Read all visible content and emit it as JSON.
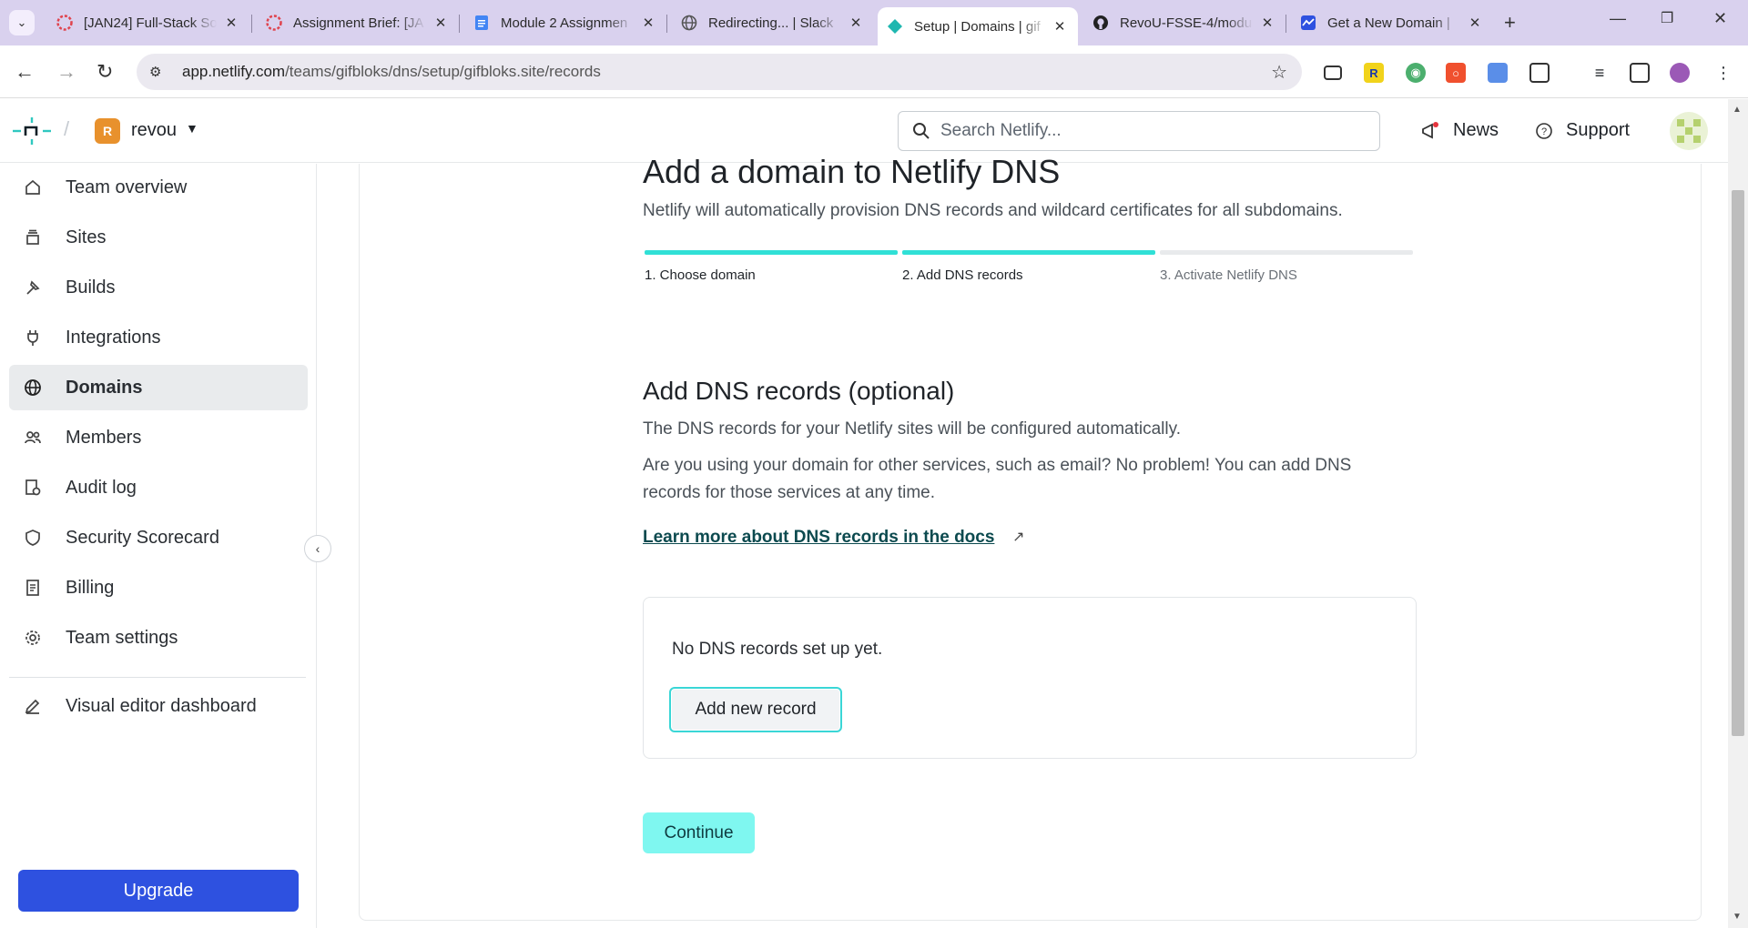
{
  "browser": {
    "tabs": [
      {
        "title": "[JAN24] Full-Stack So",
        "icon": "revou-icon"
      },
      {
        "title": "Assignment Brief: [JA",
        "icon": "revou-icon"
      },
      {
        "title": "Module 2 Assignmen",
        "icon": "docs-icon"
      },
      {
        "title": "Redirecting... | Slack",
        "icon": "globe-icon"
      },
      {
        "title": "Setup | Domains | gif",
        "icon": "netlify-icon",
        "active": true
      },
      {
        "title": "RevoU-FSSE-4/modu",
        "icon": "github-icon"
      },
      {
        "title": "Get a New Domain | ",
        "icon": "netlify-icon"
      }
    ],
    "url_host": "app.netlify.com",
    "url_path": "/teams/gifbloks/dns/setup/gifbloks.site/records"
  },
  "header": {
    "team_initial": "R",
    "team_name": "revou",
    "search_placeholder": "Search Netlify...",
    "news_label": "News",
    "support_label": "Support"
  },
  "sidebar": {
    "items": [
      {
        "label": "Team overview",
        "icon": "home-icon"
      },
      {
        "label": "Sites",
        "icon": "layers-icon"
      },
      {
        "label": "Builds",
        "icon": "hammer-icon"
      },
      {
        "label": "Integrations",
        "icon": "plug-icon"
      },
      {
        "label": "Domains",
        "icon": "globe-icon",
        "active": true
      },
      {
        "label": "Members",
        "icon": "users-icon"
      },
      {
        "label": "Audit log",
        "icon": "audit-icon"
      },
      {
        "label": "Security Scorecard",
        "icon": "shield-icon"
      },
      {
        "label": "Billing",
        "icon": "receipt-icon"
      },
      {
        "label": "Team settings",
        "icon": "gear-icon"
      }
    ],
    "visual_editor_label": "Visual editor dashboard",
    "upgrade_label": "Upgrade"
  },
  "main": {
    "title": "Add a domain to Netlify DNS",
    "subtitle": "Netlify will automatically provision DNS records and wildcard certificates for all subdomains.",
    "steps": [
      {
        "label": "1. Choose domain",
        "complete": true
      },
      {
        "label": "2. Add DNS records",
        "complete": true
      },
      {
        "label": "3. Activate Netlify DNS",
        "complete": false
      }
    ],
    "section_title": "Add DNS records (optional)",
    "para1": "The DNS records for your Netlify sites will be configured automatically.",
    "para2": "Are you using your domain for other services, such as email? No problem! You can add DNS records for those services at any time.",
    "docs_link": "Learn more about DNS records in the docs",
    "empty_records": "No DNS records set up yet.",
    "add_record_label": "Add new record",
    "continue_label": "Continue"
  },
  "colors": {
    "accent": "#30e0d6",
    "upgrade": "#2e51e0",
    "continue": "#7ff7f0"
  }
}
